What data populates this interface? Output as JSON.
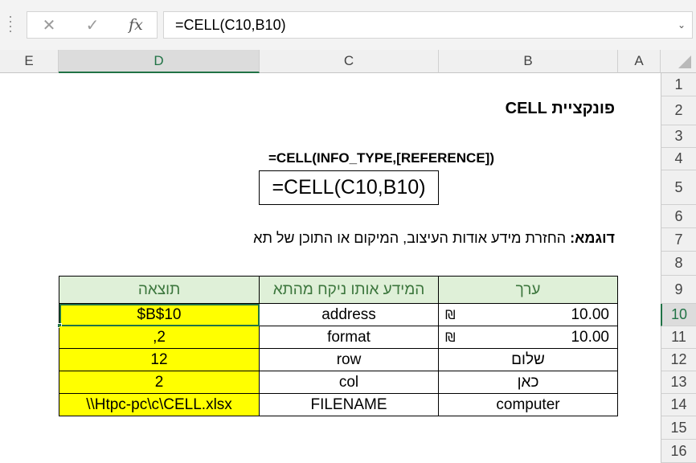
{
  "formula_bar": {
    "cancel_glyph": "✕",
    "enter_glyph": "✓",
    "fx_label": "fx",
    "formula": "=CELL(C10,B10)",
    "expand_glyph": "⌄"
  },
  "columns": [
    "E",
    "D",
    "C",
    "B",
    "A"
  ],
  "selected_column": "D",
  "rows": [
    "1",
    "2",
    "3",
    "4",
    "5",
    "6",
    "7",
    "8",
    "9",
    "10",
    "11",
    "12",
    "13",
    "14",
    "15",
    "16"
  ],
  "selected_row": "10",
  "sheet": {
    "title": "פונקציית CELL",
    "syntax": "=CELL(INFO_TYPE,[REFERENCE])",
    "formula_example": "=CELL(C10,B10)",
    "example_label": "דוגמא:",
    "example_text": " החזרת מידע אודות העיצוב, המיקום או התוכן של תא"
  },
  "table": {
    "headers": {
      "value": "ערך",
      "info": "המידע אותו ניקח מהתא",
      "result": "תוצאה"
    },
    "rows": [
      {
        "value": "10.00",
        "currency": "₪",
        "info": "address",
        "result": "$B$10"
      },
      {
        "value": "10.00",
        "currency": "₪",
        "info": "format",
        "result": ",2"
      },
      {
        "value": "שלום",
        "currency": "",
        "info": "row",
        "result": "12"
      },
      {
        "value": "כאן",
        "currency": "",
        "info": "col",
        "result": "2"
      },
      {
        "value": "computer",
        "currency": "",
        "info": "FILENAME",
        "result": "\\\\Htpc-pc\\c\\CELL.xlsx"
      }
    ]
  },
  "colors": {
    "accent": "#217346",
    "result_fill": "#ffff00",
    "header_fill": "#dff0d8",
    "header_text": "#3c763d"
  }
}
